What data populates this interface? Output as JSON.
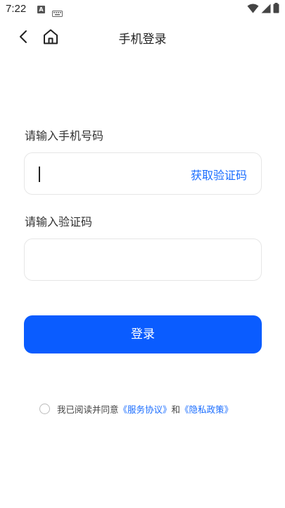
{
  "status_bar": {
    "time": "7:22",
    "icons": [
      "notification-a-icon",
      "keyboard-icon",
      "wifi-icon",
      "signal-icon",
      "battery-icon"
    ]
  },
  "nav": {
    "title": "手机登录",
    "back_icon": "chevron-left-icon",
    "home_icon": "home-icon"
  },
  "form": {
    "phone_label": "请输入手机号码",
    "phone_value": "",
    "get_code_label": "获取验证码",
    "code_label": "请输入验证码",
    "code_value": "",
    "login_label": "登录"
  },
  "agreement": {
    "checked": false,
    "prefix": "我已阅读并同意",
    "service_link": "《服务协议》",
    "and_text": "和",
    "privacy_link": "《隐私政策》"
  },
  "colors": {
    "primary": "#0a5cff",
    "link": "#1a6dff",
    "border": "#e6e6e6"
  }
}
